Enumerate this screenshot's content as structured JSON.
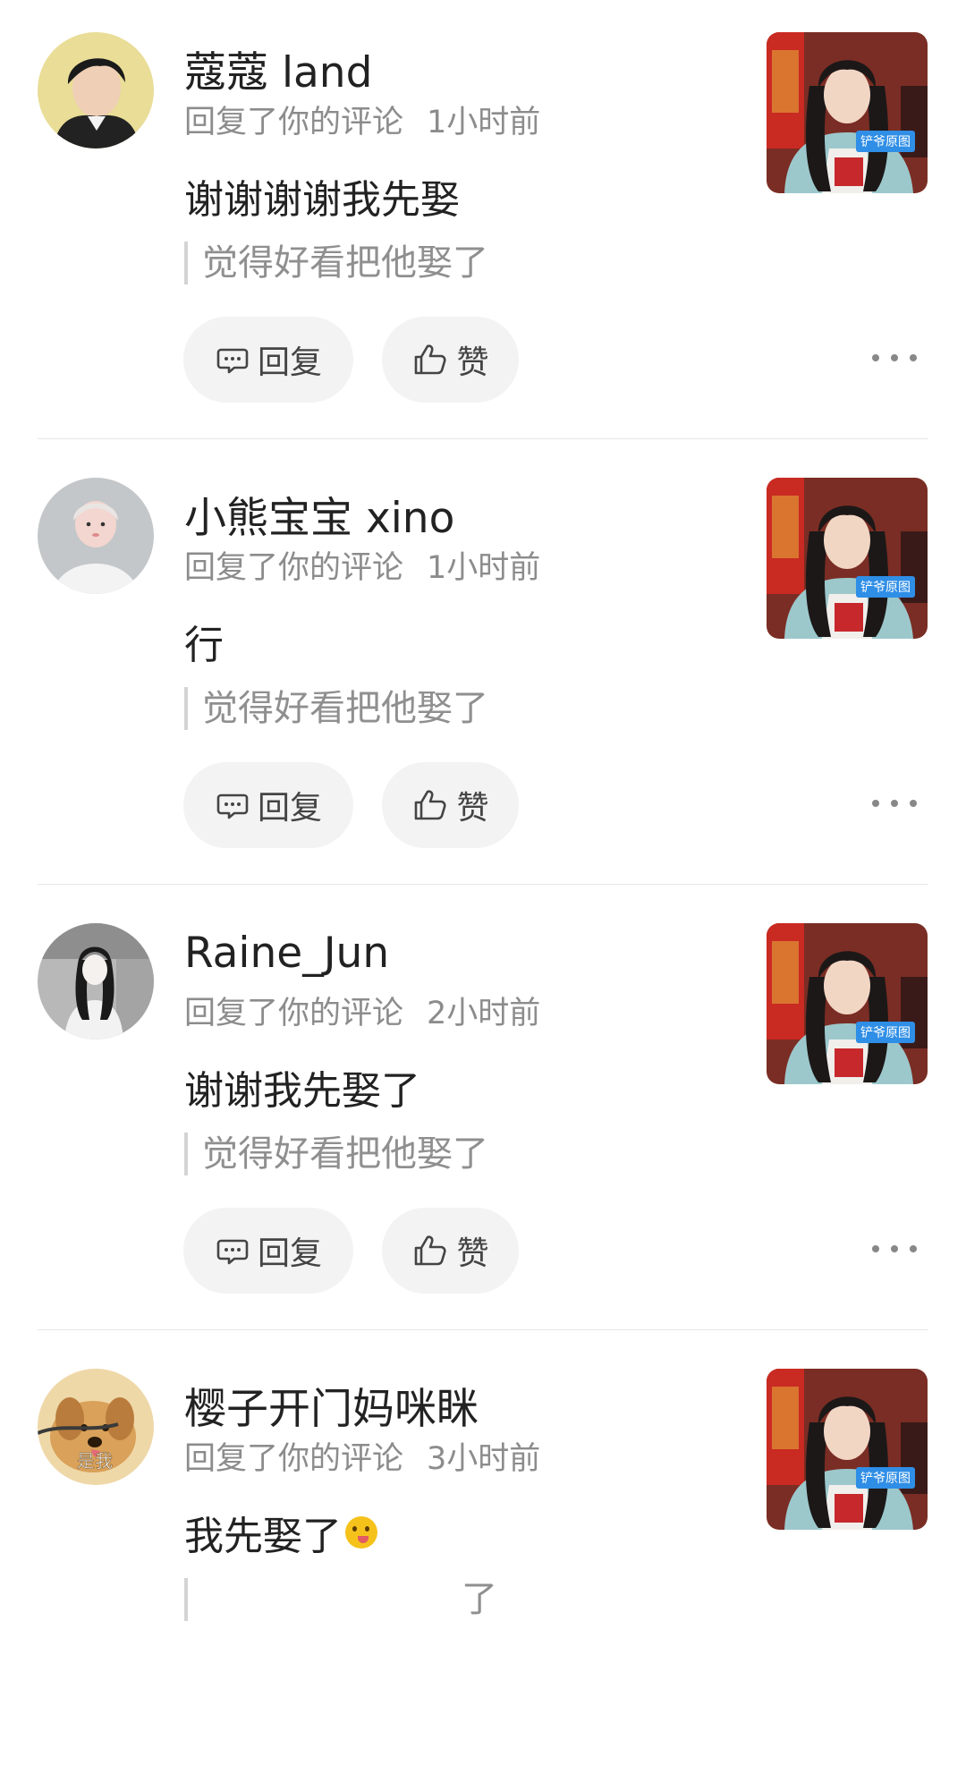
{
  "comments": [
    {
      "username": "蔻蔻 land",
      "action": "回复了你的评论",
      "time": "1小时前",
      "content": "谢谢谢谢我先娶",
      "quoted": "觉得好看把他娶了",
      "reply_label": "回复",
      "like_label": "赞",
      "thumb_badge": "铲爷原图",
      "avatar": "avatar-young-man"
    },
    {
      "username": "小熊宝宝 xino",
      "action": "回复了你的评论",
      "time": "1小时前",
      "content": "行",
      "quoted": "觉得好看把他娶了",
      "reply_label": "回复",
      "like_label": "赞",
      "thumb_badge": "铲爷原图",
      "avatar": "avatar-girl-face"
    },
    {
      "username": "Raine_Jun",
      "action": "回复了你的评论",
      "time": "2小时前",
      "content": "谢谢我先娶了",
      "quoted": "觉得好看把他娶了",
      "reply_label": "回复",
      "like_label": "赞",
      "thumb_badge": "铲爷原图",
      "avatar": "avatar-sketch-girl"
    },
    {
      "username": "樱子开门妈咪眯",
      "action": "回复了你的评论",
      "time": "3小时前",
      "content": "我先娶了",
      "quoted": "了",
      "thumb_badge": "铲爷原图",
      "avatar": "avatar-dog",
      "avatar_text": "是我",
      "emoji": "tongue-out-emoji"
    }
  ]
}
